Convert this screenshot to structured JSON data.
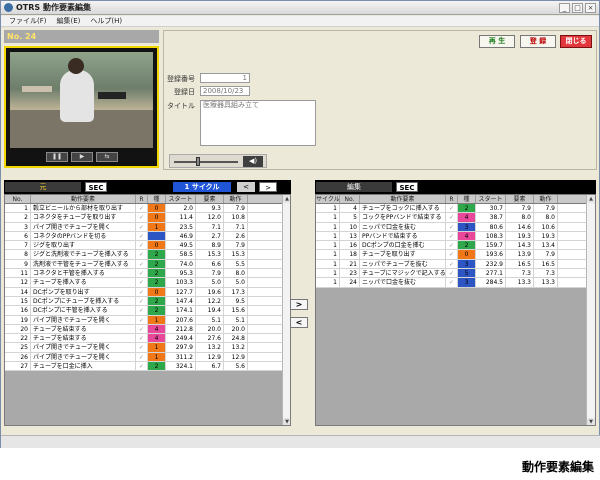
{
  "window": {
    "title": "OTRS 動作要素編集",
    "controls": [
      "_",
      "□",
      "×"
    ]
  },
  "menu": [
    "ファイル(F)",
    "編集(E)",
    "ヘルプ(H)"
  ],
  "video": {
    "number_label": "No. 24",
    "controls": [
      "❚❚",
      "▶",
      "⇆"
    ]
  },
  "actions": {
    "play": "再 生",
    "register": "登 録",
    "close": "閉じる"
  },
  "form": {
    "reg_no_label": "登録番号",
    "reg_no": "1",
    "reg_date_label": "登録日",
    "reg_date": "2008/10/23",
    "title_label": "タイトル",
    "title_value": "医療器具組み立て"
  },
  "left_panel": {
    "tag": "元",
    "sec": "SEC",
    "cycle": "1 サイクル",
    "prev": "<",
    "next": ">",
    "columns": [
      "No.",
      "動作要素",
      "R",
      "種",
      "スタート",
      "要素",
      "動作"
    ],
    "rows": [
      {
        "no": "1",
        "name": "穀立ビニールから部材を取り出す",
        "r": "✓",
        "cat": "0",
        "color": "#f07818",
        "start": "2.0",
        "elem": "9.3",
        "act": "7.9"
      },
      {
        "no": "2",
        "name": "コネクタをチューブを取り出す",
        "r": "✓",
        "cat": "0",
        "color": "#f07818",
        "start": "11.4",
        "elem": "12.0",
        "act": "10.8"
      },
      {
        "no": "3",
        "name": "パイプ開きでチューブを開く",
        "r": "✓",
        "cat": "1",
        "color": "#f07818",
        "start": "23.5",
        "elem": "7.1",
        "act": "7.1"
      },
      {
        "no": "6",
        "name": "コネクタのPPバンドを切る",
        "r": "✓",
        "cat": "",
        "color": "#2d55c4",
        "start": "46.9",
        "elem": "2.7",
        "act": "2.6"
      },
      {
        "no": "7",
        "name": "ジグを取り出す",
        "r": "✓",
        "cat": "0",
        "color": "#f07818",
        "start": "49.5",
        "elem": "8.9",
        "act": "7.9"
      },
      {
        "no": "8",
        "name": "ジグと洗剤液でチューブを挿入する",
        "r": "✓",
        "cat": "2",
        "color": "#2ea84a",
        "start": "58.5",
        "elem": "15.3",
        "act": "15.3"
      },
      {
        "no": "9",
        "name": "洗剤液で干管をチューブを挿入する",
        "r": "✓",
        "cat": "2",
        "color": "#2ea84a",
        "start": "74.0",
        "elem": "6.6",
        "act": "5.5"
      },
      {
        "no": "11",
        "name": "コネクタと干管を挿入する",
        "r": "✓",
        "cat": "2",
        "color": "#2ea84a",
        "start": "95.3",
        "elem": "7.9",
        "act": "8.0"
      },
      {
        "no": "12",
        "name": "チューブを挿入する",
        "r": "✓",
        "cat": "2",
        "color": "#2ea84a",
        "start": "103.3",
        "elem": "5.0",
        "act": "5.0"
      },
      {
        "no": "14",
        "name": "DCポンプを取り出す",
        "r": "✓",
        "cat": "0",
        "color": "#f07818",
        "start": "127.7",
        "elem": "19.6",
        "act": "17.3"
      },
      {
        "no": "15",
        "name": "DCポンプにチューブを挿入する",
        "r": "✓",
        "cat": "2",
        "color": "#2ea84a",
        "start": "147.4",
        "elem": "12.2",
        "act": "9.5"
      },
      {
        "no": "16",
        "name": "DCポンプに干管を挿入する",
        "r": "✓",
        "cat": "2",
        "color": "#2ea84a",
        "start": "174.1",
        "elem": "19.4",
        "act": "15.6"
      },
      {
        "no": "19",
        "name": "パイプ開きでチューブを開く",
        "r": "✓",
        "cat": "1",
        "color": "#f07818",
        "start": "207.6",
        "elem": "5.1",
        "act": "5.1"
      },
      {
        "no": "20",
        "name": "チューブを結束する",
        "r": "✓",
        "cat": "4",
        "color": "#e8479a",
        "start": "212.8",
        "elem": "20.0",
        "act": "20.0"
      },
      {
        "no": "22",
        "name": "チューブを結束する",
        "r": "✓",
        "cat": "4",
        "color": "#e8479a",
        "start": "249.4",
        "elem": "27.6",
        "act": "24.8"
      },
      {
        "no": "25",
        "name": "パイプ開きでチューブを開く",
        "r": "✓",
        "cat": "1",
        "color": "#f07818",
        "start": "297.9",
        "elem": "13.2",
        "act": "13.2"
      },
      {
        "no": "26",
        "name": "パイプ開きでチューブを開く",
        "r": "✓",
        "cat": "1",
        "color": "#f07818",
        "start": "311.2",
        "elem": "12.9",
        "act": "12.9"
      },
      {
        "no": "27",
        "name": "チューブを口金に挿入",
        "r": "✓",
        "cat": "2",
        "color": "#2ea84a",
        "start": "324.1",
        "elem": "6.7",
        "act": "5.6"
      }
    ]
  },
  "right_panel": {
    "tag": "編集",
    "sec": "SEC",
    "columns": [
      "サイクル",
      "No.",
      "動作要素",
      "R",
      "種",
      "スタート",
      "要素",
      "動作"
    ],
    "rows": [
      {
        "cycle": "1",
        "no": "4",
        "name": "チューブをコックに挿入する",
        "r": "✓",
        "cat": "2",
        "color": "#2ea84a",
        "start": "30.7",
        "elem": "7.9",
        "act": "7.9"
      },
      {
        "cycle": "1",
        "no": "5",
        "name": "コックをPPバンドで結束する",
        "r": "✓",
        "cat": "4",
        "color": "#e8479a",
        "start": "38.7",
        "elem": "8.0",
        "act": "8.0"
      },
      {
        "cycle": "1",
        "no": "10",
        "name": "ニッパで口金を抜む",
        "r": "✓",
        "cat": "3",
        "color": "#2d55c4",
        "start": "80.6",
        "elem": "14.6",
        "act": "10.6"
      },
      {
        "cycle": "1",
        "no": "13",
        "name": "PPバンドで結束する",
        "r": "✓",
        "cat": "4",
        "color": "#e8479a",
        "start": "108.3",
        "elem": "19.3",
        "act": "19.3"
      },
      {
        "cycle": "1",
        "no": "16",
        "name": "DCポンプの口金を挿む",
        "r": "✓",
        "cat": "2",
        "color": "#2ea84a",
        "start": "159.7",
        "elem": "14.3",
        "act": "13.4"
      },
      {
        "cycle": "1",
        "no": "18",
        "name": "チューブを取り出す",
        "r": "✓",
        "cat": "0",
        "color": "#f07818",
        "start": "193.6",
        "elem": "13.9",
        "act": "7.9"
      },
      {
        "cycle": "1",
        "no": "21",
        "name": "ニッパでチューブを抜む",
        "r": "✓",
        "cat": "3",
        "color": "#2d55c4",
        "start": "232.9",
        "elem": "16.5",
        "act": "16.5"
      },
      {
        "cycle": "1",
        "no": "23",
        "name": "チューブにマジックで記入する",
        "r": "✓",
        "cat": "5",
        "color": "#2d55c4",
        "start": "277.1",
        "elem": "7.3",
        "act": "7.3"
      },
      {
        "cycle": "1",
        "no": "24",
        "name": "ニッパで口金を抜む",
        "r": "✓",
        "cat": "3",
        "color": "#2d55c4",
        "start": "284.5",
        "elem": "13.3",
        "act": "13.3"
      }
    ]
  },
  "transfer": {
    "to_right": ">",
    "to_left": "<"
  },
  "caption": "動作要素編集"
}
